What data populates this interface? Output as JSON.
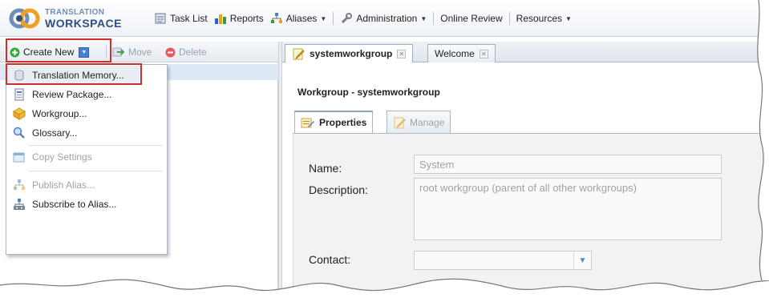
{
  "header": {
    "logo_line1": "TRANSLATION",
    "logo_line2": "WORKSPACE",
    "menu": [
      {
        "label": "Task List",
        "icon": "task-list-icon"
      },
      {
        "label": "Reports",
        "icon": "reports-icon"
      },
      {
        "label": "Aliases",
        "icon": "aliases-icon",
        "dropdown": true
      },
      {
        "label": "Administration",
        "icon": "administration-icon",
        "dropdown": true
      },
      {
        "label": "Online Review"
      },
      {
        "label": "Resources",
        "dropdown": true
      }
    ]
  },
  "left_toolbar": {
    "create_new": "Create New",
    "move": "Move",
    "delete": "Delete"
  },
  "create_menu": {
    "items": [
      {
        "label": "Translation Memory...",
        "icon": "translation-memory-icon",
        "enabled": true
      },
      {
        "label": "Review Package...",
        "icon": "review-package-icon",
        "enabled": true
      },
      {
        "label": "Workgroup...",
        "icon": "workgroup-icon",
        "enabled": true
      },
      {
        "label": "Glossary...",
        "icon": "glossary-icon",
        "enabled": true
      },
      {
        "label": "Copy Settings",
        "icon": "copy-settings-icon",
        "enabled": false
      },
      {
        "label": "Publish Alias...",
        "icon": "publish-alias-icon",
        "enabled": false
      },
      {
        "label": "Subscribe to Alias...",
        "icon": "subscribe-alias-icon",
        "enabled": true
      }
    ]
  },
  "tabs": [
    {
      "label": "systemworkgroup",
      "active": true
    },
    {
      "label": "Welcome",
      "active": false
    }
  ],
  "main": {
    "title": "Workgroup - systemworkgroup",
    "subtabs": [
      {
        "label": "Properties",
        "active": true
      },
      {
        "label": "Manage",
        "active": false
      }
    ],
    "form": {
      "name_label": "Name:",
      "name_value": "System",
      "description_label": "Description:",
      "description_value": "root workgroup (parent of all other workgroups)",
      "contact_label": "Contact:",
      "contact_value": ""
    }
  },
  "colors": {
    "annotation": "#d42b2b",
    "accent": "#4b7fd0"
  }
}
